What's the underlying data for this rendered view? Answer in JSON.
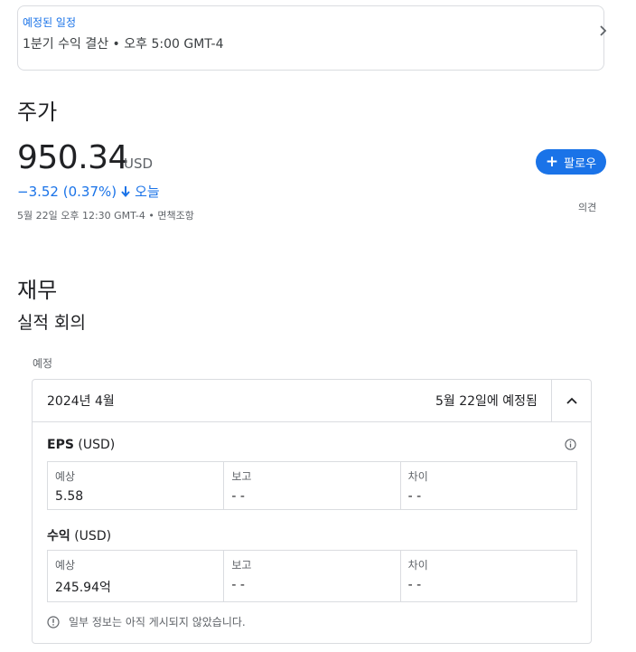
{
  "scheduled": {
    "label": "예정된 일정",
    "text": "1분기 수익 결산 • 오후 5:00 GMT-4"
  },
  "stock": {
    "heading": "주가",
    "price": "950.34",
    "currency": "USD",
    "change": "−3.52 (0.37%)",
    "change_period": "오늘",
    "timestamp": "5월 22일 오후 12:30 GMT-4 • 면책조항",
    "follow_label": "팔로우",
    "feedback_label": "의견",
    "accent_color": "#1a73e8"
  },
  "finance": {
    "heading": "재무",
    "subheading": "실적 회의",
    "scheduled_label": "예정",
    "period": "2024년 4월",
    "scheduled_date": "5월 22일에 예정됨",
    "eps": {
      "title_bold": "EPS",
      "title_unit": "(USD)",
      "cells": [
        {
          "label": "예상",
          "value": "5.58"
        },
        {
          "label": "보고",
          "value": "- -"
        },
        {
          "label": "차이",
          "value": "- -"
        }
      ]
    },
    "revenue": {
      "title_bold": "수익",
      "title_unit": "(USD)",
      "cells": [
        {
          "label": "예상",
          "value": "245.94억"
        },
        {
          "label": "보고",
          "value": "- -"
        },
        {
          "label": "차이",
          "value": "- -"
        }
      ]
    },
    "notice": "일부 정보는 아직 게시되지 않았습니다."
  }
}
